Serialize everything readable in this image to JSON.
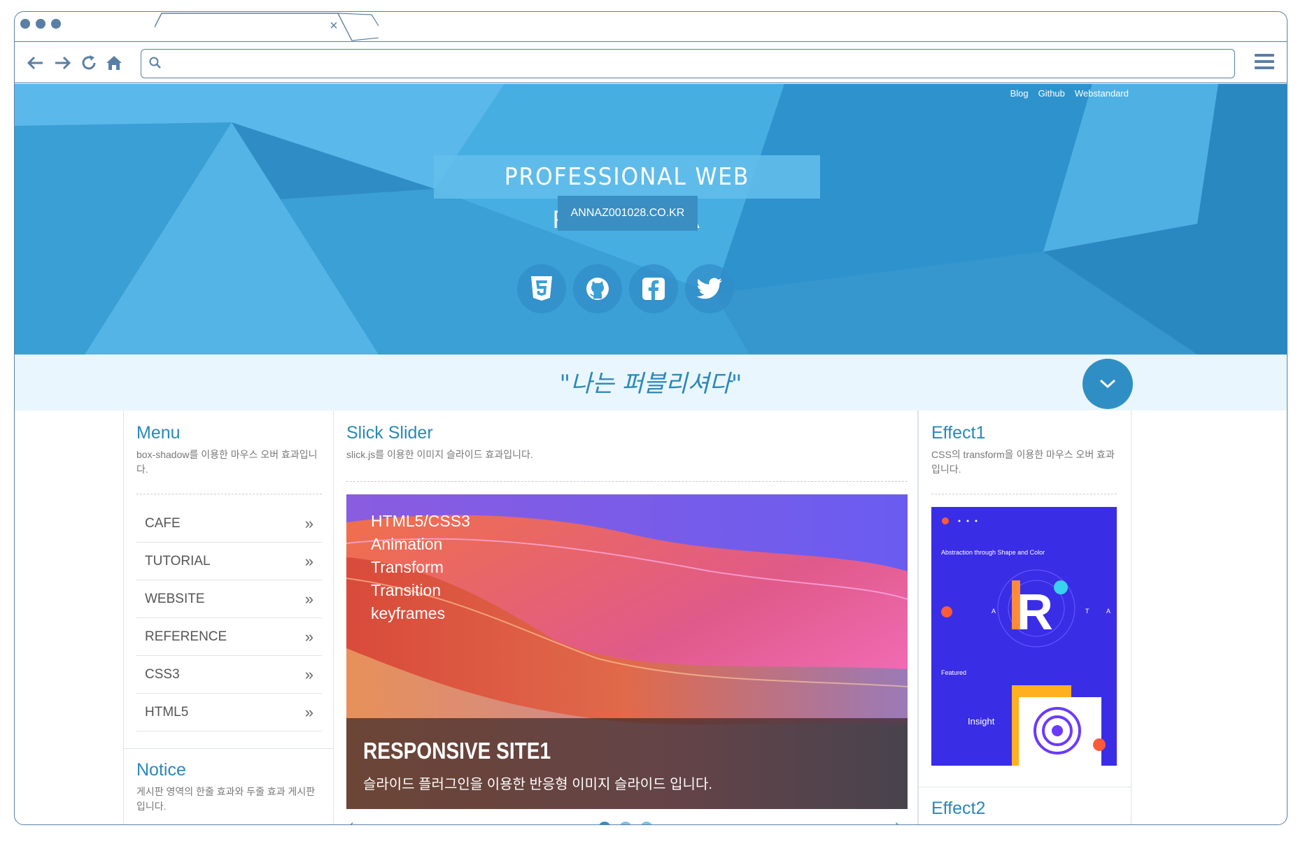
{
  "browser": {
    "tab_close": "×"
  },
  "header": {
    "nav": [
      "Blog",
      "Github",
      "Webstandard"
    ],
    "title": "PROFESSIONAL WEB PUBLISHSER",
    "subtitle": "ANNAZ001028.CO.KR",
    "social_icons": [
      "html5-icon",
      "github-icon",
      "facebook-icon",
      "twitter-icon"
    ],
    "quote": "\"나는 퍼블리셔다\""
  },
  "menu_section": {
    "title": "Menu",
    "desc": "box-shadow를 이용한 마우스 오버 효과입니다.",
    "items": [
      "CAFE",
      "TUTORIAL",
      "WEBSITE",
      "REFERENCE",
      "CSS3",
      "HTML5"
    ],
    "chevron": "»"
  },
  "notice_section": {
    "title": "Notice",
    "desc": "게시판 영역의 한줄 효과와 두줄 효과 게시판입니다."
  },
  "slider_section": {
    "title": "Slick Slider",
    "desc": "slick.js를 이용한 이미지 슬라이드 효과입니다.",
    "slide_lines": [
      "HTML5/CSS3",
      "Animation",
      "Transform",
      "Transition",
      "keyframes"
    ],
    "caption_title": "RESPONSIVE SITE1",
    "caption_text": "슬라이드 플러그인을 이용한 반응형 이미지 슬라이드 입니다.",
    "prev": "‹",
    "next": "›",
    "dots_active": 0,
    "dots_count": 3
  },
  "effect1_section": {
    "title": "Effect1",
    "desc": "CSS의 transform을 이용한 마우스 오버 효과입니다.",
    "poster_heading": "Abstraction through Shape and Color",
    "poster_letter": "R",
    "poster_letters": [
      "A",
      "T",
      "A"
    ],
    "poster_featured": "Featured",
    "poster_insight": "Insight"
  },
  "effect2_section": {
    "title": "Effect2"
  },
  "colors": {
    "frame": "#5a7fa6",
    "hero": "#3aa5dc",
    "accent": "#2a88b8"
  }
}
